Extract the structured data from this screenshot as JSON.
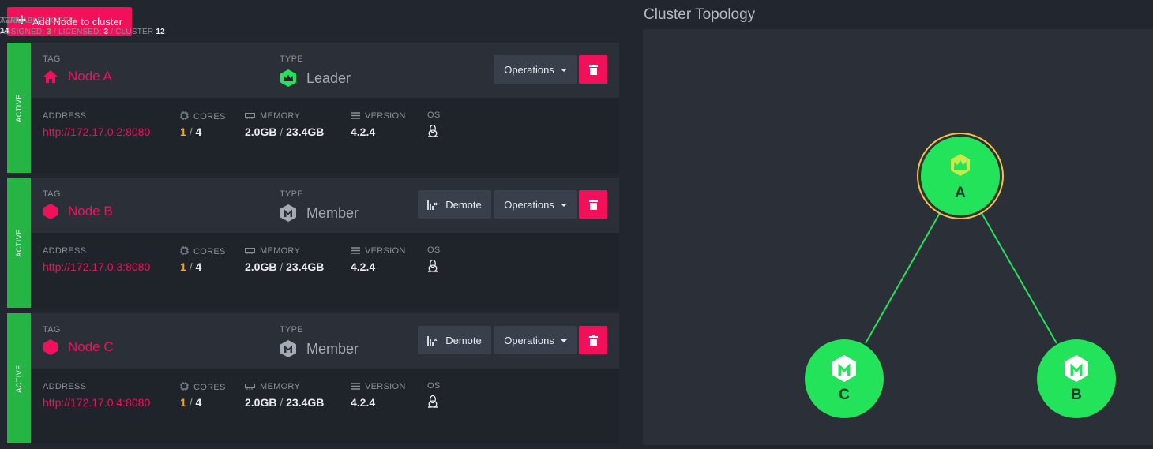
{
  "toolbar": {
    "add_label": "Add Node to cluster"
  },
  "stats": {
    "available_cores_label": "AVAILABLE CORES:",
    "assigned_label": "ASSIGNED:",
    "assigned": "3",
    "licensed_label": "/ LICENSED:",
    "licensed": "3",
    "cluster_label": "/ CLUSTER",
    "cluster": "12",
    "term_label": "TERM:",
    "term": "14"
  },
  "labels": {
    "tag": "TAG",
    "type": "TYPE",
    "address": "ADDRESS",
    "cores": "CORES",
    "memory": "MEMORY",
    "version": "VERSION",
    "os": "OS",
    "operations": "Operations",
    "demote": "Demote"
  },
  "nodes": [
    {
      "status": "ACTIVE",
      "tag": "Node A",
      "type": "Leader",
      "address": "http://172.17.0.2:8080",
      "cores_used": "1",
      "cores_total": "4",
      "mem_used": "2.0GB",
      "mem_total": "23.4GB",
      "version": "4.2.4"
    },
    {
      "status": "ACTIVE",
      "tag": "Node B",
      "type": "Member",
      "address": "http://172.17.0.3:8080",
      "cores_used": "1",
      "cores_total": "4",
      "mem_used": "2.0GB",
      "mem_total": "23.4GB",
      "version": "4.2.4"
    },
    {
      "status": "ACTIVE",
      "tag": "Node C",
      "type": "Member",
      "address": "http://172.17.0.4:8080",
      "cores_used": "1",
      "cores_total": "4",
      "mem_used": "2.0GB",
      "mem_total": "23.4GB",
      "version": "4.2.4"
    }
  ],
  "topology": {
    "title": "Cluster Topology",
    "nodes": [
      {
        "label": "A",
        "role": "leader"
      },
      {
        "label": "C",
        "role": "member"
      },
      {
        "label": "B",
        "role": "member"
      }
    ]
  },
  "colors": {
    "accent": "#f0115a",
    "active": "#26b545",
    "node_green": "#22e35a",
    "leader_ring": "#f5c242",
    "highlight": "#f5a623"
  }
}
